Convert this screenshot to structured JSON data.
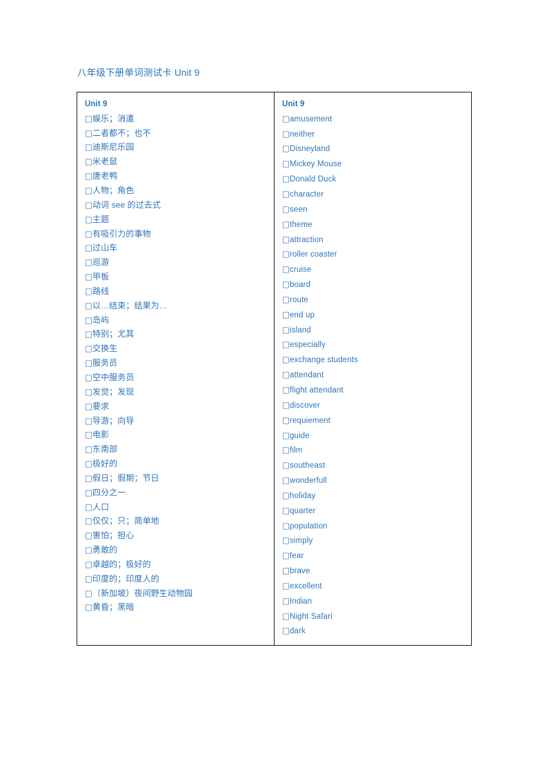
{
  "document": {
    "title": "八年级下册单词测试卡 Unit 9",
    "text_color": "#2E74B5",
    "border_color": "#1a1a1a",
    "background": "#ffffff"
  },
  "table": {
    "checkbox_glyph": "□",
    "columns": [
      {
        "id": "chinese",
        "header": "Unit 9",
        "items": [
          "娱乐；消遣",
          "二者都不；也不",
          "迪斯尼乐园",
          "米老鼠",
          "唐老鸭",
          "人物；角色",
          "动词 see 的过去式",
          "主题",
          "有吸引力的事物",
          "过山车",
          "巡游",
          "甲板",
          "路线",
          "以…结束；结果为…",
          "岛屿",
          "特别；尤其",
          "交换生",
          "服务员",
          "空中服务员",
          "发觉；发现",
          "要求",
          "导游；向导",
          "电影",
          "东南部",
          "极好的",
          "假日；假期；节日",
          "四分之一",
          "人口",
          "仅仅；只；简单地",
          "害怕；担心",
          "勇敢的",
          "卓越的；极好的",
          "印度的；印度人的",
          "（新加坡）夜间野生动物园",
          "黄昏；黑暗"
        ]
      },
      {
        "id": "english",
        "header": "Unit 9",
        "items": [
          "amusement",
          "neither",
          "Disneyland",
          "Mickey Mouse",
          "Donald Duck",
          "character",
          "seen",
          "theme",
          "attraction",
          "roller coaster",
          "cruise",
          "board",
          "route",
          "end up",
          "island",
          "especially",
          "exchange students",
          "attendant",
          "flight attendant",
          "discover",
          "requiement",
          "guide",
          "film",
          "southeast",
          "wonderfull",
          "holiday",
          "quarter",
          "population",
          "simply",
          "fear",
          "brave",
          "excellent",
          "Indian",
          "Night Safari",
          "dark"
        ]
      }
    ]
  }
}
